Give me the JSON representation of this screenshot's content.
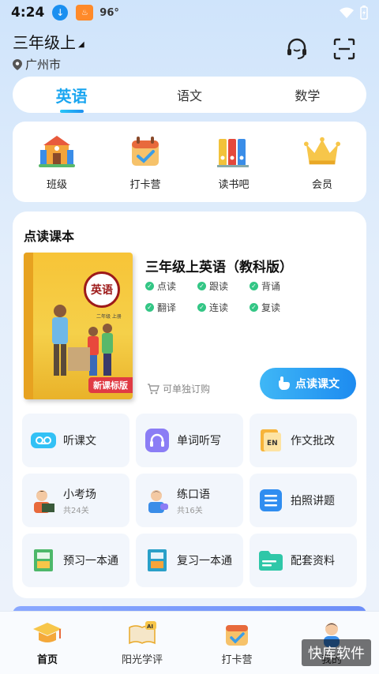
{
  "status": {
    "time": "4:24",
    "temp": "96°"
  },
  "header": {
    "grade": "三年级上",
    "location": "广州市"
  },
  "tabs": [
    {
      "label": "英语",
      "active": true
    },
    {
      "label": "语文",
      "active": false
    },
    {
      "label": "数学",
      "active": false
    }
  ],
  "quick": [
    {
      "label": "班级",
      "icon": "school-icon"
    },
    {
      "label": "打卡营",
      "icon": "calendar-check-icon"
    },
    {
      "label": "读书吧",
      "icon": "binders-icon"
    },
    {
      "label": "会员",
      "icon": "crown-icon"
    }
  ],
  "card": {
    "title": "点读课本",
    "book": {
      "cover_title": "英语",
      "cover_sub": "二年级 上册",
      "badge": "新课标版",
      "name": "三年级上英语（教科版）"
    },
    "features": [
      "点读",
      "跟读",
      "背诵",
      "翻译",
      "连读",
      "复读"
    ],
    "buy_label": "可单独订购",
    "read_button": "点读课文"
  },
  "grid": [
    {
      "label": "听课文",
      "sub": "",
      "icon": "listen-icon"
    },
    {
      "label": "单词听写",
      "sub": "",
      "icon": "headphones-icon"
    },
    {
      "label": "作文批改",
      "sub": "",
      "icon": "essay-icon"
    },
    {
      "label": "小考场",
      "sub": "共24关",
      "icon": "teacher-icon"
    },
    {
      "label": "练口语",
      "sub": "共16关",
      "icon": "speaking-icon"
    },
    {
      "label": "拍照讲题",
      "sub": "",
      "icon": "photo-list-icon"
    },
    {
      "label": "预习一本通",
      "sub": "",
      "icon": "preview-book-icon"
    },
    {
      "label": "复习一本通",
      "sub": "",
      "icon": "review-book-icon"
    },
    {
      "label": "配套资料",
      "sub": "",
      "icon": "folder-icon"
    }
  ],
  "nav": [
    {
      "label": "首页",
      "icon": "graduation-cap-icon",
      "active": true
    },
    {
      "label": "阳光学评",
      "icon": "ai-book-icon",
      "active": false
    },
    {
      "label": "打卡营",
      "icon": "calendar-check-icon",
      "active": false
    },
    {
      "label": "我的",
      "icon": "profile-icon",
      "active": false
    }
  ],
  "watermark": "快库软件"
}
